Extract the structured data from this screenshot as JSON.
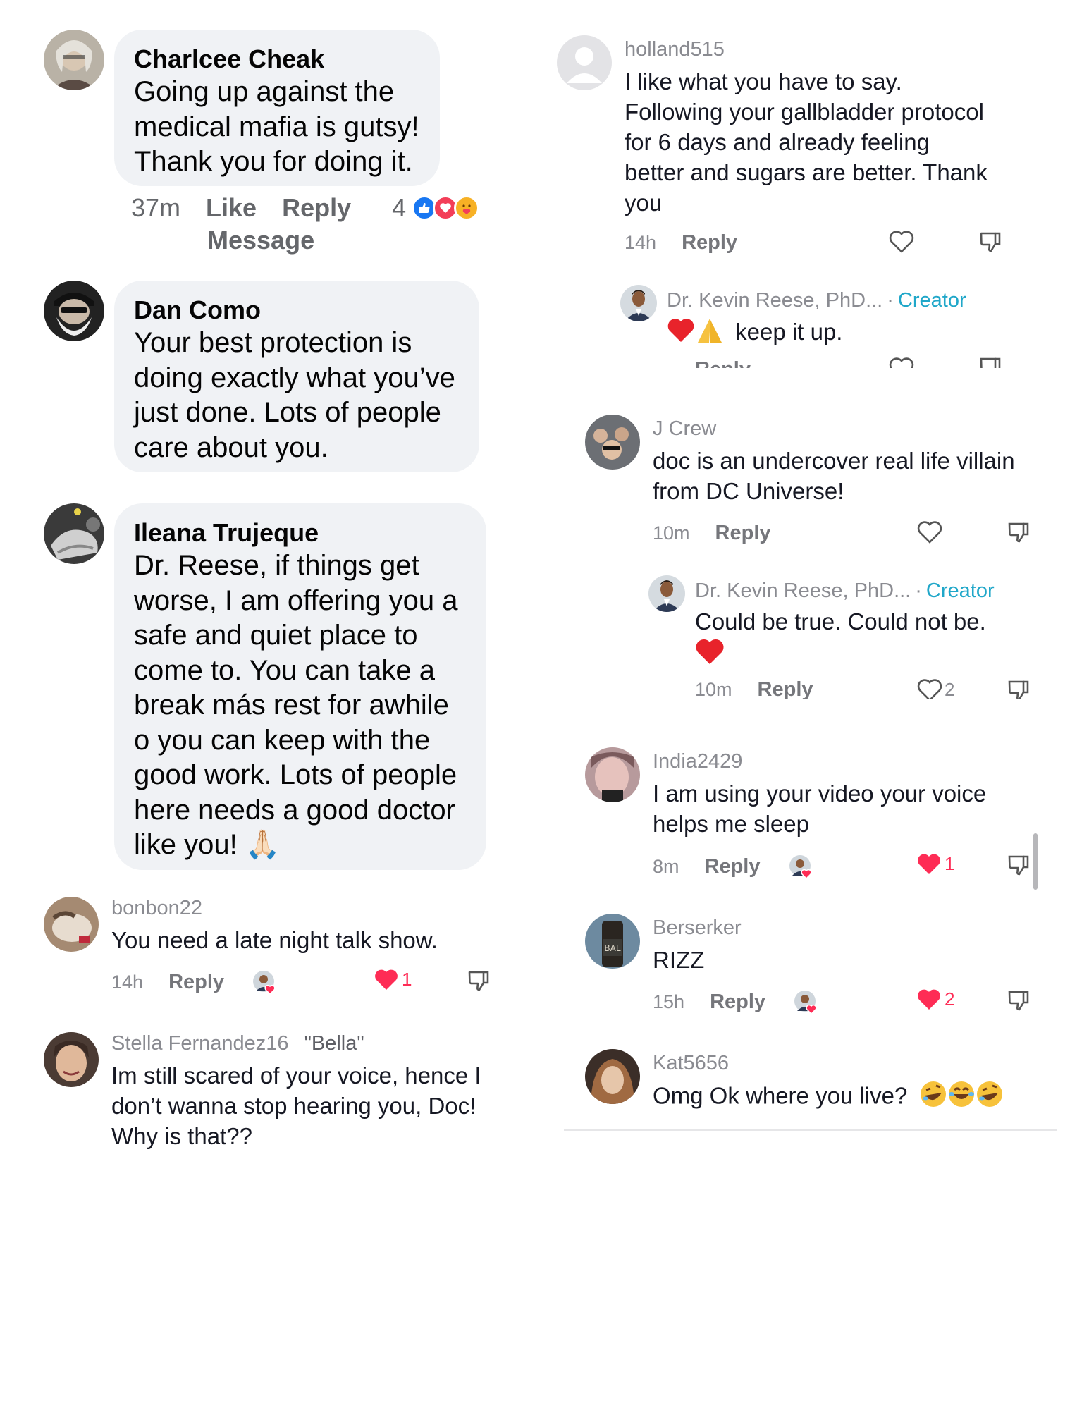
{
  "left": {
    "comments": [
      {
        "name": "Charlcee Cheak",
        "lines": [
          "Going up against the",
          "medical mafia is gutsy!",
          "Thank you for doing it."
        ],
        "time": "37m",
        "like_label": "Like",
        "reply_label": "Reply",
        "message_label": "Message",
        "reaction_count": "4",
        "reaction_icons": [
          "like-icon",
          "love-icon",
          "care-icon"
        ]
      },
      {
        "name": "Dan Como",
        "lines": [
          "Your best protection is",
          "doing exactly what you’ve",
          "just done. Lots of people",
          "care about you."
        ]
      },
      {
        "name": "Ileana Trujeque",
        "lines": [
          "Dr. Reese, if things get",
          "worse, I am offering you a",
          "safe and quiet place to",
          "come to. You can take a",
          "break más rest for awhile",
          "o you can keep with  the",
          "good work. Lots of people",
          "here needs a good doctor",
          "like you! 🙏🏻"
        ]
      }
    ],
    "tt_comments": [
      {
        "name": "bonbon22",
        "text": "You need a late night talk show.",
        "time": "14h",
        "reply_label": "Reply",
        "likes": "1"
      },
      {
        "name": "Stella Fernandez16",
        "nickname": "\"Bella\"",
        "lines": [
          "Im still scared of your voice, hence I",
          "don’t wanna stop hearing you, Doc!",
          "Why is that??"
        ]
      }
    ]
  },
  "right": {
    "comments": [
      {
        "name": "holland515",
        "lines": [
          "I like what you have to say.",
          "Following your gallbladder protocol",
          "for 6 days and already feeling",
          "better and sugars are better. Thank",
          "you"
        ],
        "time": "14h",
        "reply_label": "Reply"
      },
      {
        "name": "Dr. Kevin Reese, PhD...",
        "badge": "Creator",
        "text": "❤️🙏 keep it up.",
        "text_plain": "keep it up.",
        "reply_label": "Reply"
      },
      {
        "name": "J Crew",
        "lines": [
          "doc is an undercover real life villain",
          "from DC Universe!"
        ],
        "time": "10m",
        "reply_label": "Reply"
      },
      {
        "name": "Dr. Kevin Reese, PhD...",
        "badge": "Creator",
        "lines": [
          "Could be true. Could not be."
        ],
        "time": "10m",
        "reply_label": "Reply",
        "likes": "2"
      },
      {
        "name": "India2429",
        "lines": [
          "I am using your video your voice",
          "helps me sleep"
        ],
        "time": "8m",
        "reply_label": "Reply",
        "likes": "1"
      },
      {
        "name": "Berserker",
        "lines": [
          "RIZZ"
        ],
        "time": "15h",
        "reply_label": "Reply",
        "likes": "2"
      },
      {
        "name": "Kat5656",
        "text": "Omg Ok where you live?"
      }
    ]
  },
  "colors": {
    "creator": "#20a7c9",
    "like_red": "#fe2c55",
    "fb_blue": "#1877f2",
    "bubble": "#f0f2f5"
  }
}
